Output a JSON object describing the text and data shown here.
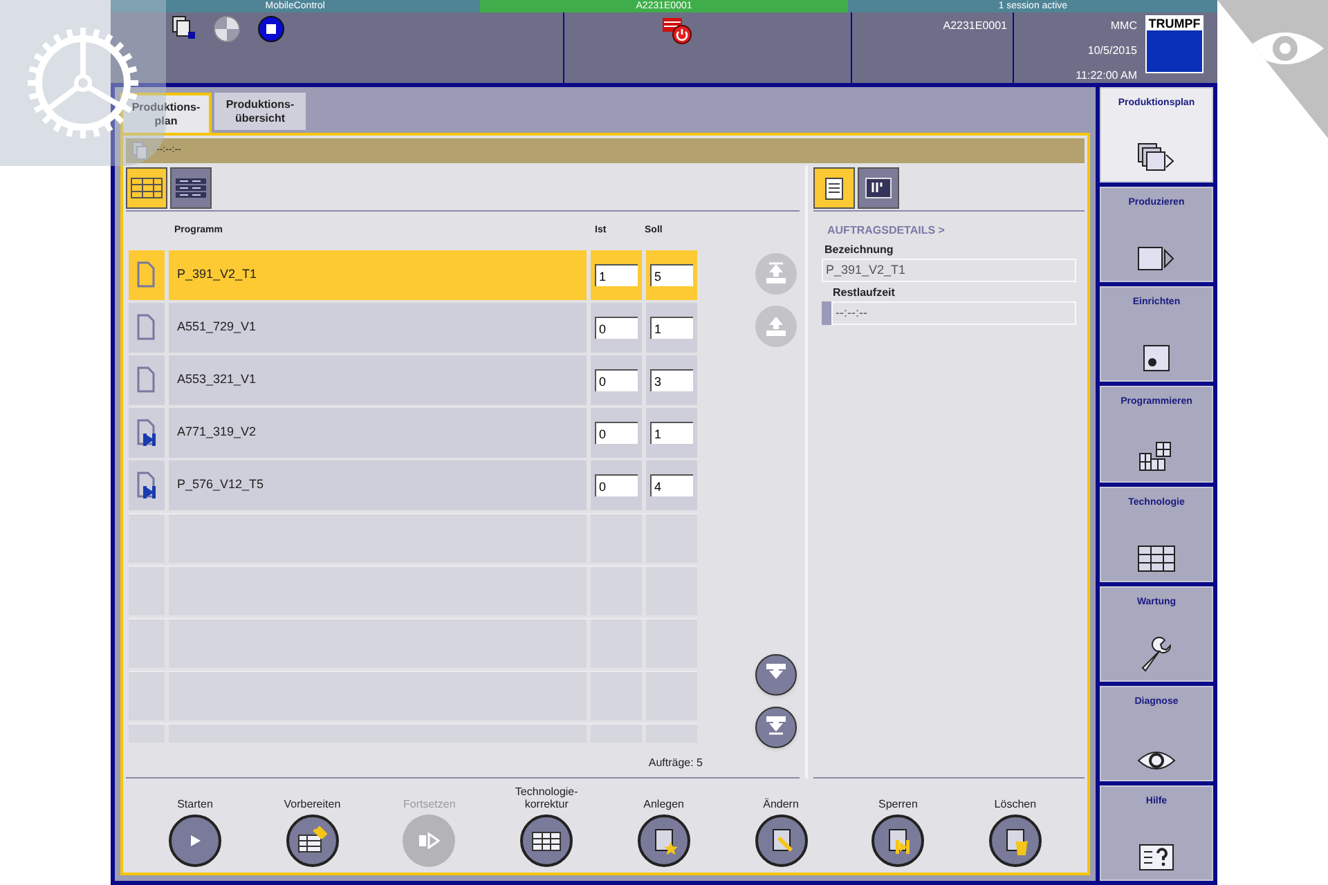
{
  "top_strip": [
    {
      "text": "MobileControl",
      "color": "#4f8496"
    },
    {
      "text": "A2231E0001",
      "color": "#3fae4a"
    },
    {
      "text": "1 session active",
      "color": "#4f8496"
    }
  ],
  "header": {
    "machine_id": "A2231E0001",
    "user": "MMC",
    "date": "10/5/2015",
    "time": "11:22:00 AM",
    "logo": "TRUMPF"
  },
  "tabs": [
    {
      "label": "Produktions-\nplan",
      "selected": true
    },
    {
      "label": "Produktions-\nübersicht",
      "selected": false
    }
  ],
  "status_text": "--:--:--",
  "list_views": [
    {
      "kind": "table",
      "selected": true
    },
    {
      "kind": "list",
      "selected": false
    }
  ],
  "table": {
    "columns": [
      "Programm",
      "Ist",
      "Soll"
    ],
    "rows": [
      {
        "kind": "program",
        "name": "P_391_V2_T1",
        "ist": "1",
        "soll": "5",
        "selected": true
      },
      {
        "kind": "program",
        "name": "A551_729_V1",
        "ist": "0",
        "soll": "1",
        "selected": false
      },
      {
        "kind": "program",
        "name": "A553_321_V1",
        "ist": "0",
        "soll": "3",
        "selected": false
      },
      {
        "kind": "linked",
        "name": "A771_319_V2",
        "ist": "0",
        "soll": "1",
        "selected": false
      },
      {
        "kind": "linked",
        "name": "P_576_V12_T5",
        "ist": "0",
        "soll": "4",
        "selected": false
      }
    ],
    "count": "Aufträge: 5"
  },
  "move_buttons": [
    {
      "kind": "top",
      "disabled": true
    },
    {
      "kind": "up",
      "disabled": true
    },
    {
      "kind": "down",
      "disabled": false
    },
    {
      "kind": "bottom",
      "disabled": false
    }
  ],
  "detail_views": [
    {
      "kind": "details",
      "selected": true
    },
    {
      "kind": "parts",
      "selected": false
    }
  ],
  "details": {
    "heading": "AUFTRAGSDETAILS >",
    "fields": [
      {
        "label": "Bezeichnung",
        "value": "P_391_V2_T1"
      },
      {
        "label": "Restlaufzeit",
        "value": "--:--:--",
        "marker": true
      }
    ]
  },
  "actions": [
    {
      "label": "Starten",
      "kind": "play",
      "disabled": false
    },
    {
      "label": "Vorbereiten",
      "kind": "prepare",
      "disabled": false
    },
    {
      "label": "Fortsetzen",
      "kind": "resume",
      "disabled": true
    },
    {
      "label": "Technologie-\nkorrektur",
      "kind": "table",
      "disabled": false
    },
    {
      "label": "Anlegen",
      "kind": "new",
      "disabled": false
    },
    {
      "label": "Ändern",
      "kind": "edit",
      "disabled": false
    },
    {
      "label": "Sperren",
      "kind": "lock",
      "disabled": false
    },
    {
      "label": "Löschen",
      "kind": "delete",
      "disabled": false
    }
  ],
  "nav": [
    {
      "label": "Produktionsplan",
      "kind": "plan",
      "selected": true
    },
    {
      "label": "Produzieren",
      "kind": "produce",
      "selected": false
    },
    {
      "label": "Einrichten",
      "kind": "setup",
      "selected": false
    },
    {
      "label": "Programmieren",
      "kind": "program",
      "selected": false
    },
    {
      "label": "Technologie",
      "kind": "technology",
      "selected": false
    },
    {
      "label": "Wartung",
      "kind": "service",
      "selected": false
    },
    {
      "label": "Diagnose",
      "kind": "diagnosis",
      "selected": false
    },
    {
      "label": "Hilfe",
      "kind": "help",
      "selected": false
    }
  ]
}
